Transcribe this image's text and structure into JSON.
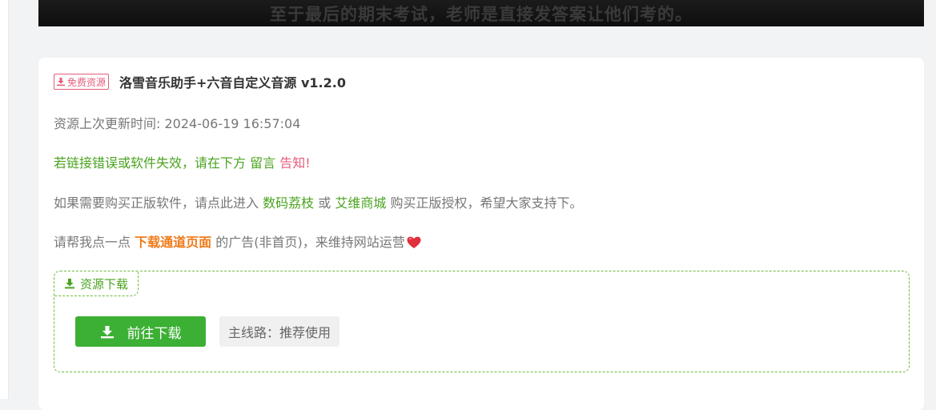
{
  "video": {
    "subtitle": "至于最后的期末考试，老师是直接发答案让他们考的。"
  },
  "post": {
    "badge_label": "免费资源",
    "title": "洛雪音乐助手+六音自定义音源 v1.2.0",
    "updated_label": "资源上次更新时间: 2024-06-19 16:57:04",
    "notice": {
      "text_before": "若链接错误或软件失效，请在下方",
      "link_comment": "留言",
      "link_report": "告知",
      "text_after": "!"
    },
    "purchase": {
      "text_before": "如果需要购买正版软件，请点此进入",
      "link_store1": "数码荔枝",
      "text_or": "或",
      "link_store2": "艾维商城",
      "text_after": "购买正版授权，希望大家支持下。"
    },
    "support": {
      "text_before": "请帮我点一点",
      "link_download_page": "下载通道页面",
      "text_after": "的广告(非首页)，来维持网站运营"
    }
  },
  "download_box": {
    "tab_label": "资源下载",
    "button_label": "前往下载",
    "route_label": "主线路：推荐使用"
  },
  "colors": {
    "accent_green": "#3cb034",
    "link_green": "#4aa31f",
    "badge_pink": "#e35d7b",
    "highlight_orange": "#f07b1a",
    "heart_red": "#e0303c"
  },
  "icons": {
    "badge": "download-icon",
    "tab": "download-icon",
    "button": "download-icon",
    "support": "heart-icon"
  }
}
